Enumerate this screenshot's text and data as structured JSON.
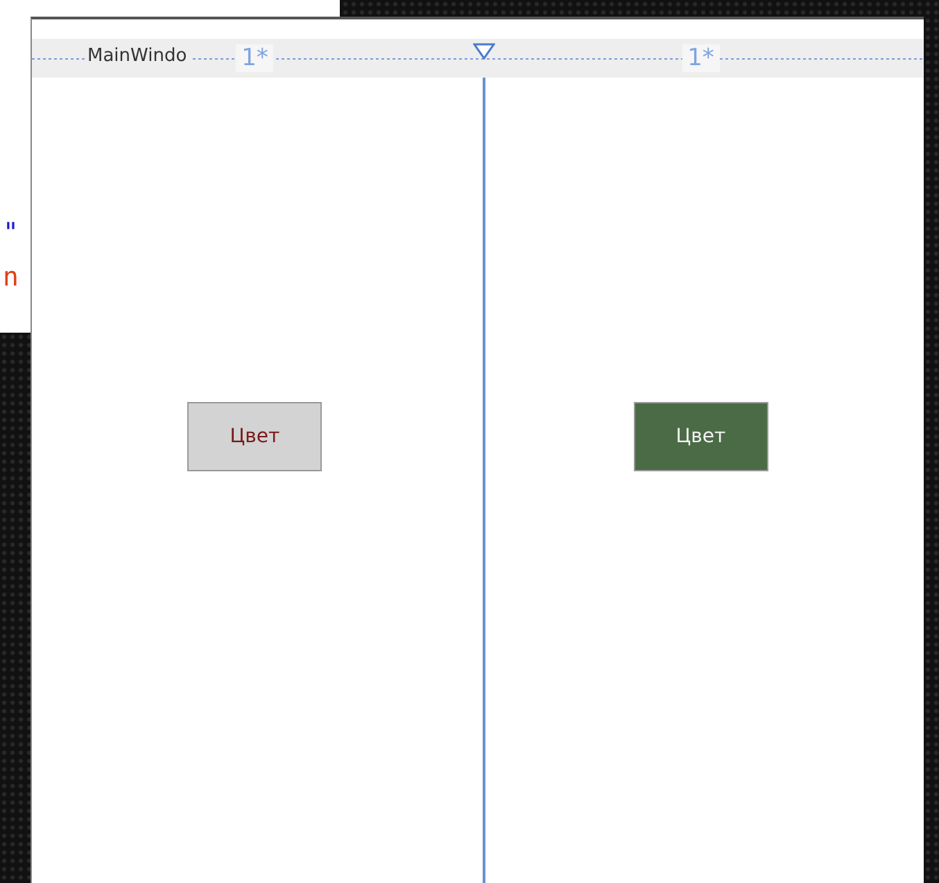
{
  "editor": {
    "lines": [
      {
        "text": "\"",
        "kind": "string"
      },
      {
        "text": "n",
        "kind": "attribute"
      }
    ]
  },
  "designer": {
    "window_title": "MainWindo",
    "columns": [
      {
        "size": "1*",
        "button": {
          "label": "Цвет",
          "kind": "default",
          "color": "#d3d3d3"
        }
      },
      {
        "size": "1*",
        "button": {
          "label": "Цвет",
          "kind": "custom",
          "color": "#4a6b45"
        }
      }
    ]
  }
}
